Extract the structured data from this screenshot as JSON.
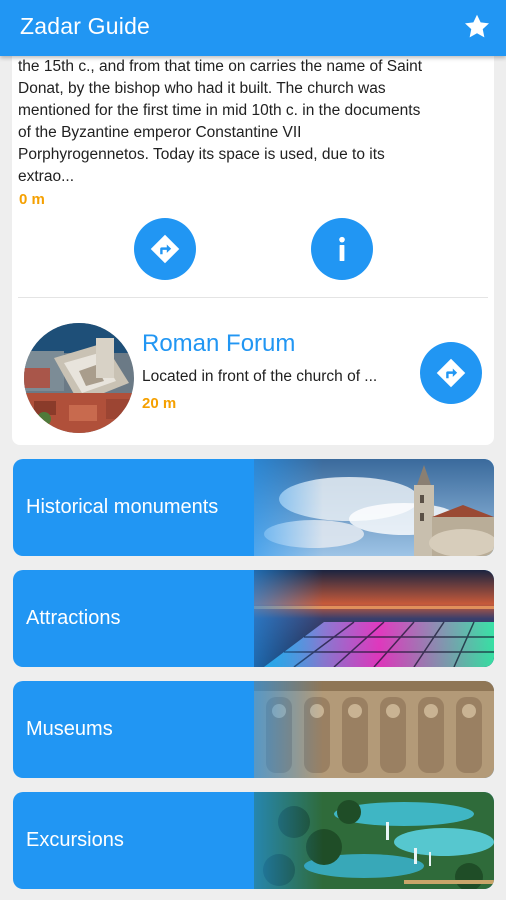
{
  "app": {
    "title": "Zadar Guide",
    "favorite_icon": "star-icon"
  },
  "detail": {
    "description_lines": [
      "the 15th c., and from that time on carries the name of Saint",
      "Donat, by the bishop who had it built. The church was",
      "mentioned for the first time in mid 10th c. in the documents",
      "of the Byzantine emperor Constantine VII",
      "Porphyrogennetos. Today its space is used, due to its",
      "extrao..."
    ],
    "distance": "0 m",
    "navigate_icon": "directions-icon",
    "info_icon": "info-icon"
  },
  "nearby": {
    "title": "Roman Forum",
    "snippet": "Located in front of the church of ...",
    "distance": "20 m",
    "navigate_icon": "directions-icon"
  },
  "categories": [
    {
      "label": "Historical monuments"
    },
    {
      "label": "Attractions"
    },
    {
      "label": "Museums"
    },
    {
      "label": "Excursions"
    }
  ],
  "colors": {
    "primary": "#2196f3",
    "distance": "#f5a000",
    "background": "#eeeeee"
  }
}
